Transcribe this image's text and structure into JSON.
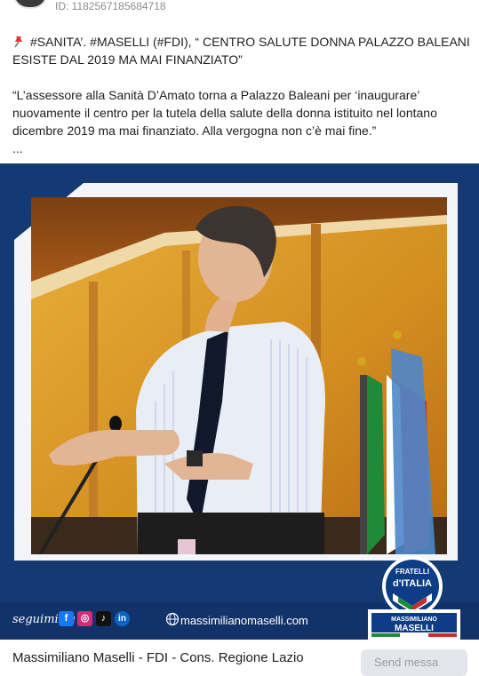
{
  "post": {
    "id_text": "ID: 1182567185684718",
    "headline": "#SANITA’. #MASELLI (#FDI), “ CENTRO SALUTE DONNA PALAZZO BALEANI ESISTE DAL 2019 MA MAI FINANZIATO”",
    "quote": "“L’assessore alla Sanità D’Amato torna a Palazzo Baleani per ‘inaugurare’ nuovamente il centro per la tutela della salute della donna istituito nel lontano dicembre 2019 ma mai finanziato. Alla vergogna non c’è mai fine.”",
    "ellipsis": "..."
  },
  "media": {
    "follow_text": "seguimi su",
    "socials": [
      {
        "icon": "facebook-icon",
        "glyph": "f",
        "color": "#1877f2"
      },
      {
        "icon": "instagram-icon",
        "glyph": "◎",
        "color": "#d62976"
      },
      {
        "icon": "tiktok-icon",
        "glyph": "♪",
        "color": "#111111"
      },
      {
        "icon": "linkedin-icon",
        "glyph": "in",
        "color": "#0a66c2"
      }
    ],
    "website": "massimilianomaselli.com",
    "logo": {
      "line1": "FRATELLI",
      "line2": "d'ITALIA",
      "first_name": "MASSIMILIANO",
      "last_name": "MASELLI"
    },
    "colors": {
      "frame": "#153a73",
      "bar": "#12336a",
      "logo_blue": "#0c3d86"
    }
  },
  "footer": {
    "page_name": "Massimiliano Maselli - FDI - Cons. Regione Lazio",
    "send_button": "Send messa"
  }
}
